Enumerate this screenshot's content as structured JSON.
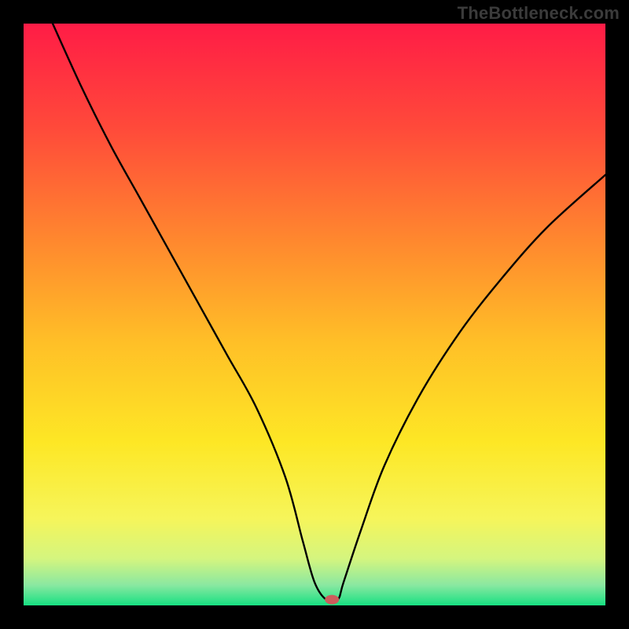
{
  "watermark": "TheBottleneck.com",
  "chart_data": {
    "type": "line",
    "title": "",
    "xlabel": "",
    "ylabel": "",
    "xlim": [
      0,
      100
    ],
    "ylim": [
      0,
      100
    ],
    "legend": false,
    "grid": false,
    "background_gradient_stops": [
      {
        "offset": 0.0,
        "color": "#ff1c46"
      },
      {
        "offset": 0.18,
        "color": "#ff4a3a"
      },
      {
        "offset": 0.38,
        "color": "#ff8a2e"
      },
      {
        "offset": 0.55,
        "color": "#ffc027"
      },
      {
        "offset": 0.72,
        "color": "#fde725"
      },
      {
        "offset": 0.85,
        "color": "#f6f55a"
      },
      {
        "offset": 0.92,
        "color": "#d4f57f"
      },
      {
        "offset": 0.965,
        "color": "#8ae8a1"
      },
      {
        "offset": 1.0,
        "color": "#17e082"
      }
    ],
    "series": [
      {
        "name": "bottleneck-curve",
        "x": [
          5,
          10,
          15,
          20,
          25,
          30,
          35,
          40,
          45,
          48,
          50,
          52,
          54,
          55,
          58,
          62,
          68,
          75,
          82,
          90,
          100
        ],
        "y": [
          100,
          89,
          79,
          70,
          61,
          52,
          43,
          34,
          22,
          11,
          4,
          1,
          1,
          4,
          13,
          24,
          36,
          47,
          56,
          65,
          74
        ]
      }
    ],
    "marker": {
      "x": 53,
      "y": 1,
      "color": "#cd5c5c",
      "rx": 9,
      "ry": 6
    }
  }
}
